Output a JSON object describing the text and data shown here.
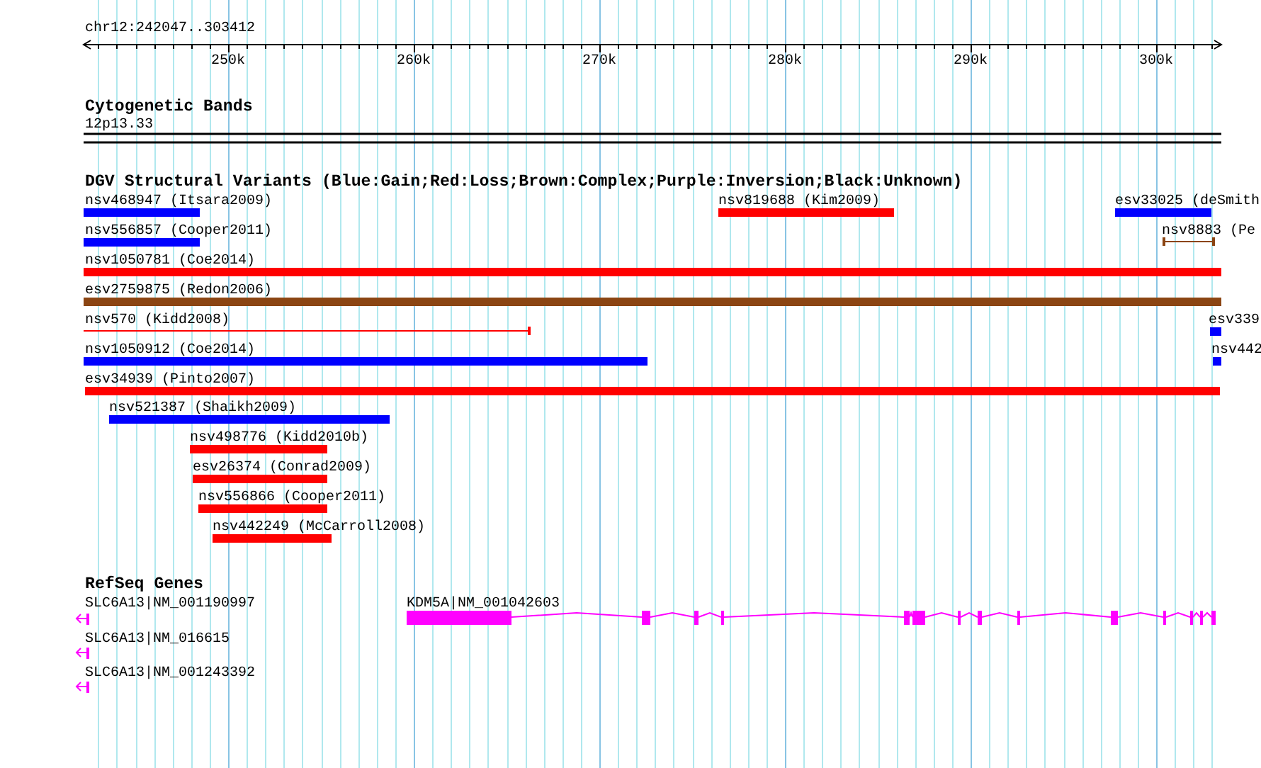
{
  "ruler": {
    "region": "chr12:242047..303412",
    "ticks": [
      "250k",
      "260k",
      "270k",
      "280k",
      "290k",
      "300k"
    ]
  },
  "tracks": [
    {
      "kind": "cytoband",
      "title": "Cytogenetic Bands",
      "band": "12p13.33"
    },
    {
      "kind": "variants",
      "title": "DGV Structural Variants (Blue:Gain;Red:Loss;Brown:Complex;Purple:Inversion;Black:Unknown)",
      "features": [
        {
          "label": "nsv468947 (Itsara2009)",
          "kind": "bar",
          "color": "#0000ff"
        },
        {
          "label": "nsv819688 (Kim2009)",
          "kind": "bar",
          "color": "#ff0000"
        },
        {
          "label": "esv33025 (deSmith",
          "kind": "bar",
          "color": "#0000ff"
        },
        {
          "label": "nsv556857 (Cooper2011)",
          "kind": "bar",
          "color": "#0000ff"
        },
        {
          "label": "nsv8883 (Pe",
          "kind": "span",
          "color": "#8b4513"
        },
        {
          "label": "nsv1050781 (Coe2014)",
          "kind": "bar",
          "color": "#ff0000"
        },
        {
          "label": "esv2759875 (Redon2006)",
          "kind": "bar",
          "color": "#8b4513"
        },
        {
          "label": "nsv570 (Kidd2008)",
          "kind": "span",
          "color": "#ff0000"
        },
        {
          "label": "esv339",
          "kind": "bar",
          "color": "#0000ff"
        },
        {
          "label": "nsv1050912 (Coe2014)",
          "kind": "bar",
          "color": "#0000ff"
        },
        {
          "label": "nsv442",
          "kind": "bar",
          "color": "#0000ff"
        },
        {
          "label": "esv34939 (Pinto2007)",
          "kind": "bar",
          "color": "#ff0000"
        },
        {
          "label": "nsv521387 (Shaikh2009)",
          "kind": "bar",
          "color": "#0000ff"
        },
        {
          "label": "nsv498776 (Kidd2010b)",
          "kind": "bar",
          "color": "#ff0000"
        },
        {
          "label": "esv26374 (Conrad2009)",
          "kind": "bar",
          "color": "#ff0000"
        },
        {
          "label": "nsv556866 (Cooper2011)",
          "kind": "bar",
          "color": "#ff0000"
        },
        {
          "label": "nsv442249 (McCarroll2008)",
          "kind": "bar",
          "color": "#ff0000"
        }
      ]
    },
    {
      "kind": "genes",
      "title": "RefSeq Genes",
      "features": [
        {
          "label": "SLC6A13|NM_001190997",
          "kind": "clipped"
        },
        {
          "label": "KDM5A|NM_001042603",
          "kind": "transcript"
        },
        {
          "label": "SLC6A13|NM_016615",
          "kind": "clipped"
        },
        {
          "label": "SLC6A13|NM_001243392",
          "kind": "clipped"
        }
      ]
    }
  ]
}
